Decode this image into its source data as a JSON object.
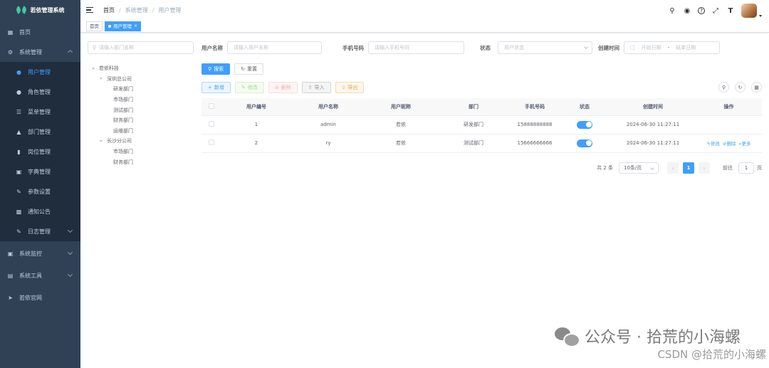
{
  "app": {
    "title": "若依管理系统"
  },
  "sidebar": {
    "items": [
      {
        "label": "首页",
        "icon": "dashboard-icon"
      },
      {
        "label": "系统管理",
        "icon": "gear-icon",
        "expanded": true
      },
      {
        "label": "用户管理",
        "icon": "user-icon",
        "active": true
      },
      {
        "label": "角色管理",
        "icon": "peoples-icon"
      },
      {
        "label": "菜单管理",
        "icon": "tree-table-icon"
      },
      {
        "label": "部门管理",
        "icon": "tree-icon"
      },
      {
        "label": "岗位管理",
        "icon": "post-icon"
      },
      {
        "label": "字典管理",
        "icon": "dict-icon"
      },
      {
        "label": "参数设置",
        "icon": "edit-icon"
      },
      {
        "label": "通知公告",
        "icon": "message-icon"
      },
      {
        "label": "日志管理",
        "icon": "log-icon"
      },
      {
        "label": "系统监控",
        "icon": "monitor-icon"
      },
      {
        "label": "系统工具",
        "icon": "tool-icon"
      },
      {
        "label": "若依官网",
        "icon": "guide-icon"
      }
    ]
  },
  "navbar": {
    "breadcrumb": [
      "首页",
      "系统管理",
      "用户管理"
    ],
    "sep": "/"
  },
  "tags": {
    "home": "首页",
    "active": "用户管理",
    "close": "×"
  },
  "dept_tree": {
    "search_placeholder": "请输入部门名称",
    "nodes": {
      "root": "若依科技",
      "shenzhen": "深圳总公司",
      "sz_rd": "研发部门",
      "sz_market": "市场部门",
      "sz_test": "测试部门",
      "sz_finance": "财务部门",
      "sz_ops": "运维部门",
      "changsha": "长沙分公司",
      "cs_market": "市场部门",
      "cs_finance": "财务部门"
    }
  },
  "search": {
    "username_label": "用户名称",
    "username_placeholder": "请输入用户名称",
    "phone_label": "手机号码",
    "phone_placeholder": "请输入手机号码",
    "status_label": "状态",
    "status_placeholder": "用户状态",
    "created_label": "创建时间",
    "start_placeholder": "开始日期",
    "range_sep": "-",
    "end_placeholder": "结束日期",
    "search_btn": "搜索",
    "reset_btn": "重置"
  },
  "toolbar": {
    "add": "新增",
    "edit": "修改",
    "delete": "删除",
    "import": "导入",
    "export": "导出"
  },
  "table": {
    "headers": [
      "用户编号",
      "用户名称",
      "用户昵称",
      "部门",
      "手机号码",
      "状态",
      "创建时间",
      "操作"
    ],
    "rows": [
      {
        "id": "1",
        "username": "admin",
        "nickname": "若依",
        "dept": "研发部门",
        "phone": "15888888888",
        "status": true,
        "created": "2024-06-30 11:27:11",
        "ops": []
      },
      {
        "id": "2",
        "username": "ry",
        "nickname": "若依",
        "dept": "测试部门",
        "phone": "15666666666",
        "status": true,
        "created": "2024-06-30 11:27:11",
        "ops": [
          "修改",
          "删除",
          "更多"
        ]
      }
    ]
  },
  "pagination": {
    "total_text": "共 2 条",
    "page_size": "10条/页",
    "current": "1",
    "goto_label": "前往",
    "goto_value": "1",
    "page_suffix": "页"
  },
  "watermark": {
    "text": "公众号 · 拾荒的小海螺",
    "csdn": "CSDN @拾荒的小海螺"
  },
  "colors": {
    "sidebar": "#304156",
    "submenu": "#1f2d3d",
    "accent": "#409eff"
  }
}
